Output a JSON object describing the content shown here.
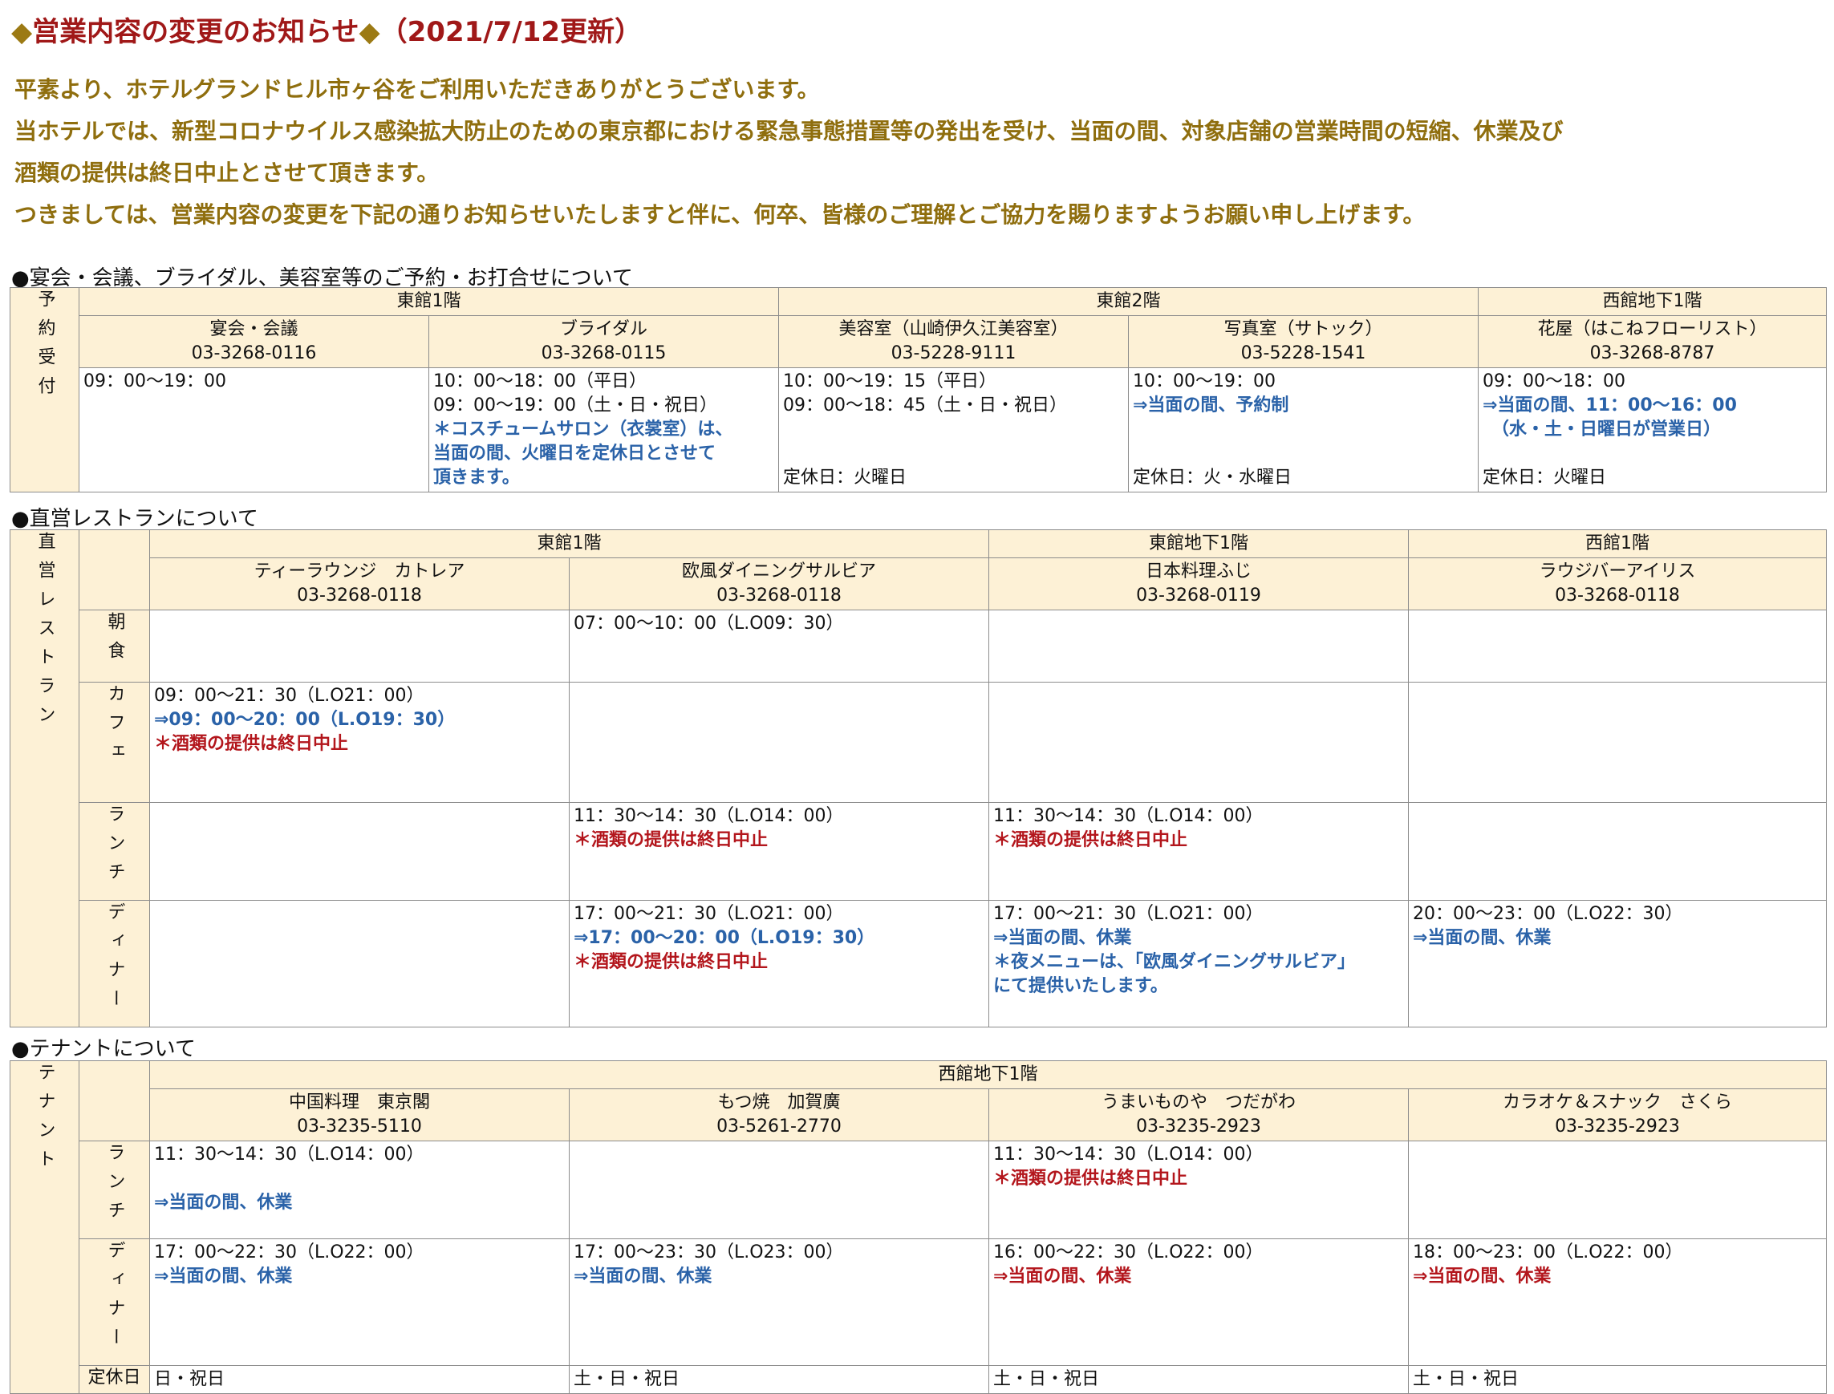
{
  "title": {
    "prefix": "◆",
    "main": "営業内容の変更のお知らせ",
    "suffix": "◆",
    "date": "（2021/7/12更新）"
  },
  "intro": [
    "平素より、ホテルグランドヒル市ヶ谷をご利用いただきありがとうございます。",
    "当ホテルでは、新型コロナウイルス感染拡大防止のための東京都における緊急事態措置等の発出を受け、当面の間、対象店舗の営業時間の短縮、休業及び",
    "酒類の提供は終日中止とさせて頂きます。",
    "つきましては、営業内容の変更を下記の通りお知らせいたしますと伴に、何卒、皆様のご理解とご協力を賜りますようお願い申し上げます。"
  ],
  "section1": {
    "heading": "●宴会・会議、ブライダル、美容室等のご予約・お打合せについて",
    "row_label": "予約受付",
    "floors": [
      "東館1階",
      "東館2階",
      "西館地下1階"
    ],
    "venues": [
      {
        "name": "宴会・会議",
        "tel": "03-3268-0116",
        "lines": [
          {
            "t": "09：00～19：00",
            "c": ""
          }
        ],
        "closed": ""
      },
      {
        "name": "ブライダル",
        "tel": "03-3268-0115",
        "lines": [
          {
            "t": "10：00～18：00（平日）",
            "c": ""
          },
          {
            "t": "09：00～19：00（土・日・祝日）",
            "c": ""
          },
          {
            "t": "＊コスチュームサロン（衣裳室）は、",
            "c": "blue"
          },
          {
            "t": "当面の間、火曜日を定休日とさせて",
            "c": "blue"
          },
          {
            "t": "頂きます。",
            "c": "blue"
          }
        ],
        "closed": ""
      },
      {
        "name": "美容室（山崎伊久江美容室）",
        "tel": "03-5228-9111",
        "lines": [
          {
            "t": "10：00～19：15（平日）",
            "c": ""
          },
          {
            "t": "09：00～18：45（土・日・祝日）",
            "c": ""
          }
        ],
        "closed": "定休日：火曜日"
      },
      {
        "name": "写真室（サトック）",
        "tel": "03-5228-1541",
        "lines": [
          {
            "t": "10：00～19：00",
            "c": ""
          },
          {
            "t": "⇒当面の間、予約制",
            "c": "blue"
          }
        ],
        "closed": "定休日：火・水曜日"
      },
      {
        "name": "花屋（はこねフローリスト）",
        "tel": "03-3268-8787",
        "lines": [
          {
            "t": "09：00～18：00",
            "c": ""
          },
          {
            "t": "⇒当面の間、11：00～16：00",
            "c": "blue"
          },
          {
            "t": "　（水・土・日曜日が営業日）",
            "c": "blue"
          }
        ],
        "closed": "定休日：火曜日"
      }
    ]
  },
  "section2": {
    "heading": "●直営レストランについて",
    "group_label": "直営レストラン",
    "floors": [
      "東館1階",
      "東館地下1階",
      "西館1階"
    ],
    "venues": [
      {
        "name": "ティーラウンジ　カトレア",
        "tel": "03-3268-0118"
      },
      {
        "name": "欧風ダイニングサルビア",
        "tel": "03-3268-0118"
      },
      {
        "name": "日本料理ふじ",
        "tel": "03-3268-0119"
      },
      {
        "name": "ラウジバーアイリス",
        "tel": "03-3268-0118"
      }
    ],
    "rows": [
      {
        "label": "朝食",
        "cells": [
          [],
          [
            {
              "t": "07：00～10：00（L.O09：30）",
              "c": ""
            }
          ],
          [],
          []
        ]
      },
      {
        "label": "カフェ",
        "cells": [
          [
            {
              "t": "09：00～21：30（L.O21：00）",
              "c": ""
            },
            {
              "t": "⇒09：00～20：00（L.O19：30）",
              "c": "blue"
            },
            {
              "t": "＊酒類の提供は終日中止",
              "c": "red"
            }
          ],
          [],
          [],
          []
        ]
      },
      {
        "label": "ランチ",
        "cells": [
          [],
          [
            {
              "t": "11：30～14：30（L.O14：00）",
              "c": ""
            },
            {
              "t": "＊酒類の提供は終日中止",
              "c": "red"
            }
          ],
          [
            {
              "t": "11：30～14：30（L.O14：00）",
              "c": ""
            },
            {
              "t": "＊酒類の提供は終日中止",
              "c": "red"
            }
          ],
          []
        ]
      },
      {
        "label": "ディナー",
        "cells": [
          [],
          [
            {
              "t": "17：00～21：30（L.O21：00）",
              "c": ""
            },
            {
              "t": "⇒17：00～20：00（L.O19：30）",
              "c": "blue"
            },
            {
              "t": "＊酒類の提供は終日中止",
              "c": "red"
            }
          ],
          [
            {
              "t": "17：00～21：30（L.O21：00）",
              "c": ""
            },
            {
              "t": "⇒当面の間、休業",
              "c": "blue"
            },
            {
              "t": "＊夜メニューは、「欧風ダイニングサルビア」",
              "c": "blue"
            },
            {
              "t": "にて提供いたします。",
              "c": "blue"
            }
          ],
          [
            {
              "t": "20：00～23：00（L.O22：30）",
              "c": ""
            },
            {
              "t": "⇒当面の間、休業",
              "c": "blue"
            }
          ]
        ]
      }
    ]
  },
  "section3": {
    "heading": "●テナントについて",
    "group_label": "テナント",
    "floor": "西館地下1階",
    "venues": [
      {
        "name": "中国料理　東京閣",
        "tel": "03-3235-5110"
      },
      {
        "name": "もつ焼　加賀廣",
        "tel": "03-5261-2770"
      },
      {
        "name": "うまいものや　つだがわ",
        "tel": "03-3235-2923"
      },
      {
        "name": "カラオケ＆スナック　さくら",
        "tel": "03-3235-2923"
      }
    ],
    "rows": [
      {
        "label": "ランチ",
        "cells": [
          [
            {
              "t": "11：30～14：30（L.O14：00）",
              "c": ""
            },
            {
              "t": "",
              "c": ""
            },
            {
              "t": "⇒当面の間、休業",
              "c": "blue"
            }
          ],
          [],
          [
            {
              "t": "11：30～14：30（L.O14：00）",
              "c": ""
            },
            {
              "t": "＊酒類の提供は終日中止",
              "c": "red"
            }
          ],
          []
        ]
      },
      {
        "label": "ディナー",
        "cells": [
          [
            {
              "t": "17：00～22：30（L.O22：00）",
              "c": ""
            },
            {
              "t": "⇒当面の間、休業",
              "c": "blue"
            }
          ],
          [
            {
              "t": "17：00～23：30（L.O23：00）",
              "c": ""
            },
            {
              "t": "⇒当面の間、休業",
              "c": "blue"
            }
          ],
          [
            {
              "t": "16：00～22：30（L.O22：00）",
              "c": ""
            },
            {
              "t": "⇒当面の間、休業",
              "c": "red"
            }
          ],
          [
            {
              "t": "18：00～23：00（L.O22：00）",
              "c": ""
            },
            {
              "t": "⇒当面の間、休業",
              "c": "red"
            }
          ]
        ]
      }
    ],
    "closed_label": "定休日",
    "closed": [
      "日・祝日",
      "土・日・祝日",
      "土・日・祝日",
      "土・日・祝日"
    ]
  }
}
